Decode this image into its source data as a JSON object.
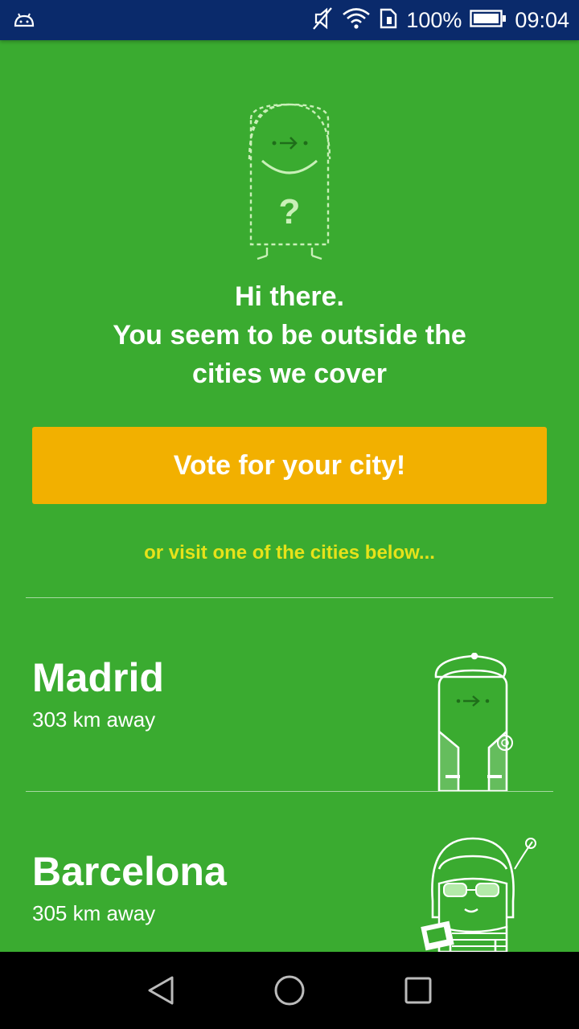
{
  "status_bar": {
    "battery": "100%",
    "time": "09:04",
    "icons": [
      "android-icon",
      "mute-icon",
      "wifi-icon",
      "sim-icon",
      "battery-icon"
    ]
  },
  "main": {
    "greeting_line1": "Hi there.",
    "greeting_line2": "You seem to be outside the",
    "greeting_line3": "cities we cover",
    "vote_button_label": "Vote for your city!",
    "visit_prompt": "or visit one of the cities below...",
    "cities": [
      {
        "name": "Madrid",
        "distance": "303 km away"
      },
      {
        "name": "Barcelona",
        "distance": "305 km away"
      }
    ]
  },
  "nav_bar": {
    "icons": [
      "back-icon",
      "home-icon",
      "recents-icon"
    ]
  },
  "colors": {
    "background": "#3aab30",
    "status_bar": "#0a2a6b",
    "button": "#f2b000",
    "prompt_text": "#e6e21a"
  }
}
